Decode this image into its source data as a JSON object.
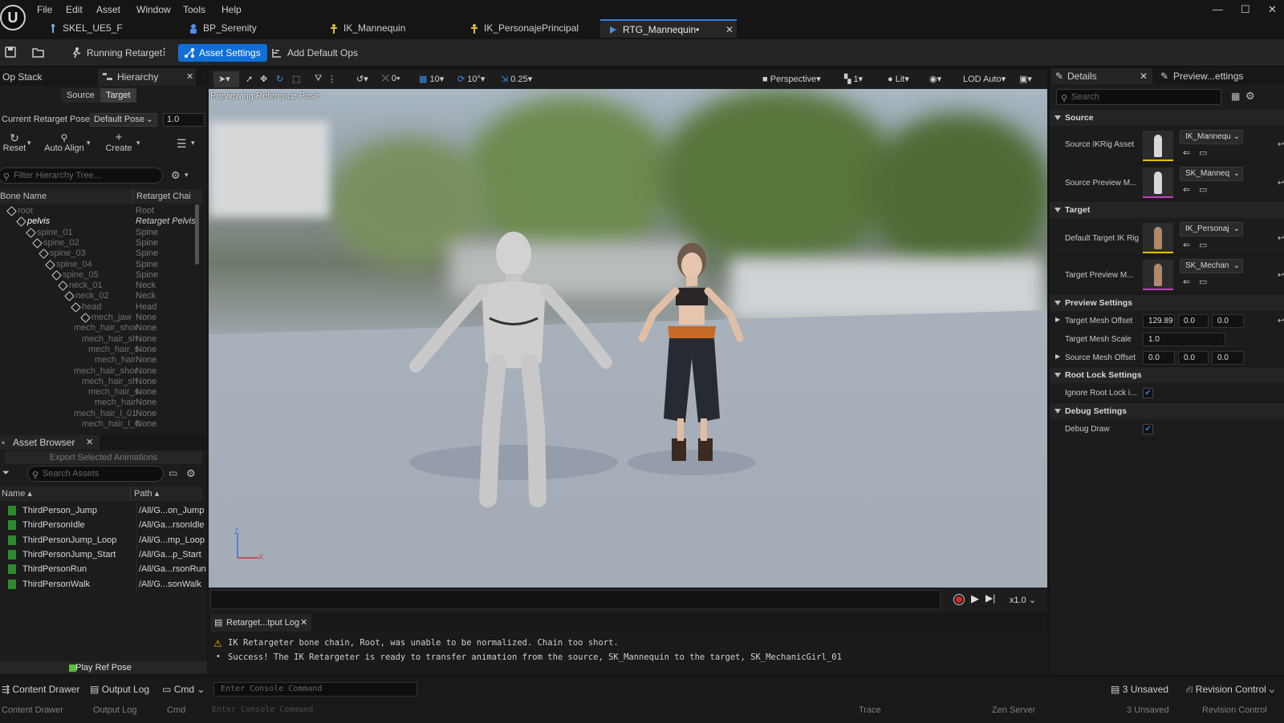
{
  "menu": [
    "File",
    "Edit",
    "Asset",
    "Window",
    "Tools",
    "Help"
  ],
  "doc_tabs": [
    "SKEL_UE5_F",
    "BP_Serenity",
    "IK_Mannequin",
    "IK_PersonajePrincipal",
    "RTG_Mannequin•"
  ],
  "toolbar": {
    "running": "Running Retarget",
    "asset_settings": "Asset Settings",
    "add_default_ops": "Add Default Ops"
  },
  "left": {
    "tab_opstack": "Op Stack",
    "tab_hierarchy": "Hierarchy",
    "seg_source": "Source",
    "seg_target": "Target",
    "pose_label": "Current Retarget Pose:",
    "pose_value": "Default Pose",
    "pose_amount": "1.0",
    "btn_reset": "Reset",
    "btn_auto_align": "Auto Align",
    "btn_create": "Create",
    "filter_placeholder": "Filter Hierarchy Tree...",
    "col_bone": "Bone Name",
    "col_chain": "Retarget Chain",
    "bones": [
      {
        "name": "root",
        "chain": "Root"
      },
      {
        "name": "pelvis",
        "chain": "Retarget Pelvis"
      },
      {
        "name": "spine_01",
        "chain": "Spine"
      },
      {
        "name": "spine_02",
        "chain": "Spine"
      },
      {
        "name": "spine_03",
        "chain": "Spine"
      },
      {
        "name": "spine_04",
        "chain": "Spine"
      },
      {
        "name": "spine_05",
        "chain": "Spine"
      },
      {
        "name": "neck_01",
        "chain": "Neck"
      },
      {
        "name": "neck_02",
        "chain": "Neck"
      },
      {
        "name": "head",
        "chain": "Head"
      },
      {
        "name": "mech_jaw",
        "chain": "None"
      },
      {
        "name": "mech_hair_shor",
        "chain": "None"
      },
      {
        "name": "mech_hair_sh",
        "chain": "None"
      },
      {
        "name": "mech_hair_s",
        "chain": "None"
      },
      {
        "name": "mech_hair",
        "chain": "None"
      },
      {
        "name": "mech_hair_shor",
        "chain": "None"
      },
      {
        "name": "mech_hair_sh",
        "chain": "None"
      },
      {
        "name": "mech_hair_s",
        "chain": "None"
      },
      {
        "name": "mech_hair",
        "chain": "None"
      },
      {
        "name": "mech_hair_l_01",
        "chain": "None"
      },
      {
        "name": "mech_hair_l_0",
        "chain": "None"
      }
    ]
  },
  "assets": {
    "title": "Asset Browser",
    "export": "Export Selected Animations",
    "search_placeholder": "Search Assets",
    "col_name": "Name",
    "col_path": "Path",
    "items": [
      {
        "name": "ThirdPerson_Jump",
        "path": "/All/G...on_Jump"
      },
      {
        "name": "ThirdPersonIdle",
        "path": "/All/Ga...rsonIdle"
      },
      {
        "name": "ThirdPersonJump_Loop",
        "path": "/All/G...mp_Loop"
      },
      {
        "name": "ThirdPersonJump_Start",
        "path": "/All/Ga...p_Start"
      },
      {
        "name": "ThirdPersonRun",
        "path": "/All/Ga...rsonRun"
      },
      {
        "name": "ThirdPersonWalk",
        "path": "/All/G...sonWalk"
      }
    ],
    "play_ref": "Play Ref Pose"
  },
  "viewport": {
    "snap_move": "0",
    "snap_grid": "10",
    "snap_rot": "10°",
    "snap_scale": "0.25",
    "perspective": "Perspective",
    "cam_speed": "1",
    "view_mode": "Lit",
    "lod": "LOD Auto",
    "overlay": "Previewing Reference Pose",
    "axis_z": "Z",
    "axis_x": "X",
    "speed": "x1.0"
  },
  "log": {
    "tab": "Retarget...tput Log",
    "warn": "IK Retargeter bone chain, Root, was unable to be normalized. Chain too short.",
    "success": "Success! The IK Retargeter is ready to transfer animation from the source, SK_Mannequin to the target, SK_MechanicGirl_01"
  },
  "details": {
    "tab_details": "Details",
    "tab_preview": "Preview...ettings",
    "search_placeholder": "Search",
    "sec_source": "Source",
    "source_ik_label": "Source IKRig Asset",
    "source_ik_value": "IK_Mannequ",
    "source_prev_label": "Source Preview M...",
    "source_prev_value": "SK_Manneq",
    "sec_target": "Target",
    "target_ik_label": "Default Target IK Rig",
    "target_ik_value": "IK_Personaj",
    "target_prev_label": "Target Preview M...",
    "target_prev_value": "SK_Mechan",
    "sec_preview": "Preview Settings",
    "tmo_label": "Target Mesh Offset",
    "tmo": [
      "129.89",
      "0.0",
      "0.0"
    ],
    "tms_label": "Target Mesh Scale",
    "tms": "1.0",
    "smo_label": "Source Mesh Offset",
    "smo": [
      "0.0",
      "0.0",
      "0.0"
    ],
    "sec_rootlock": "Root Lock Settings",
    "ignore_label": "Ignore Root Lock i...",
    "sec_debug": "Debug Settings",
    "debug_label": "Debug Draw"
  },
  "status": {
    "content_drawer": "Content Drawer",
    "output_log": "Output Log",
    "cmd": "Cmd",
    "console_placeholder": "Enter Console Command",
    "unsaved": "3 Unsaved",
    "revision": "Revision Control",
    "trace": "Trace",
    "zen": "Zen Server"
  }
}
